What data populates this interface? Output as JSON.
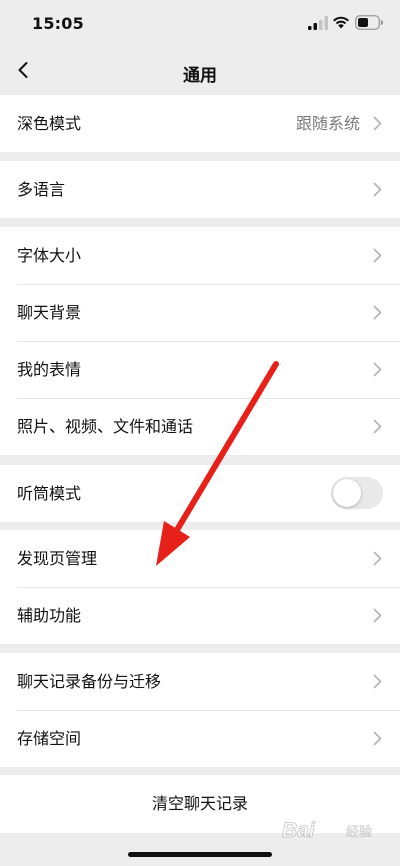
{
  "status_bar": {
    "time": "15:05",
    "icons": [
      "signal-icon",
      "wifi-icon",
      "battery-icon"
    ]
  },
  "nav": {
    "title": "通用",
    "back_icon": "chevron-left-icon"
  },
  "groups": {
    "dark_mode": {
      "label": "深色模式",
      "value": "跟随系统"
    },
    "language": {
      "label": "多语言"
    },
    "display": {
      "font_size": "字体大小",
      "chat_background": "聊天背景",
      "my_stickers": "我的表情",
      "media_files": "照片、视频、文件和通话"
    },
    "earpiece": {
      "label": "听筒模式",
      "enabled": false
    },
    "discover": {
      "discover_management": "发现页管理",
      "accessibility": "辅助功能"
    },
    "storage": {
      "backup_migrate": "聊天记录备份与迁移",
      "storage_space": "存储空间"
    }
  },
  "clear_button": {
    "label": "清空聊天记录"
  },
  "annotation": {
    "color": "#e8201a",
    "points_to": "发现页管理"
  },
  "watermark": {
    "logo_text": "Bai",
    "sub_text": "经验"
  },
  "colors": {
    "background": "#ededed",
    "cell": "#ffffff",
    "value_text": "#7a7a7a",
    "toggle_off": "#e9e9ea"
  }
}
